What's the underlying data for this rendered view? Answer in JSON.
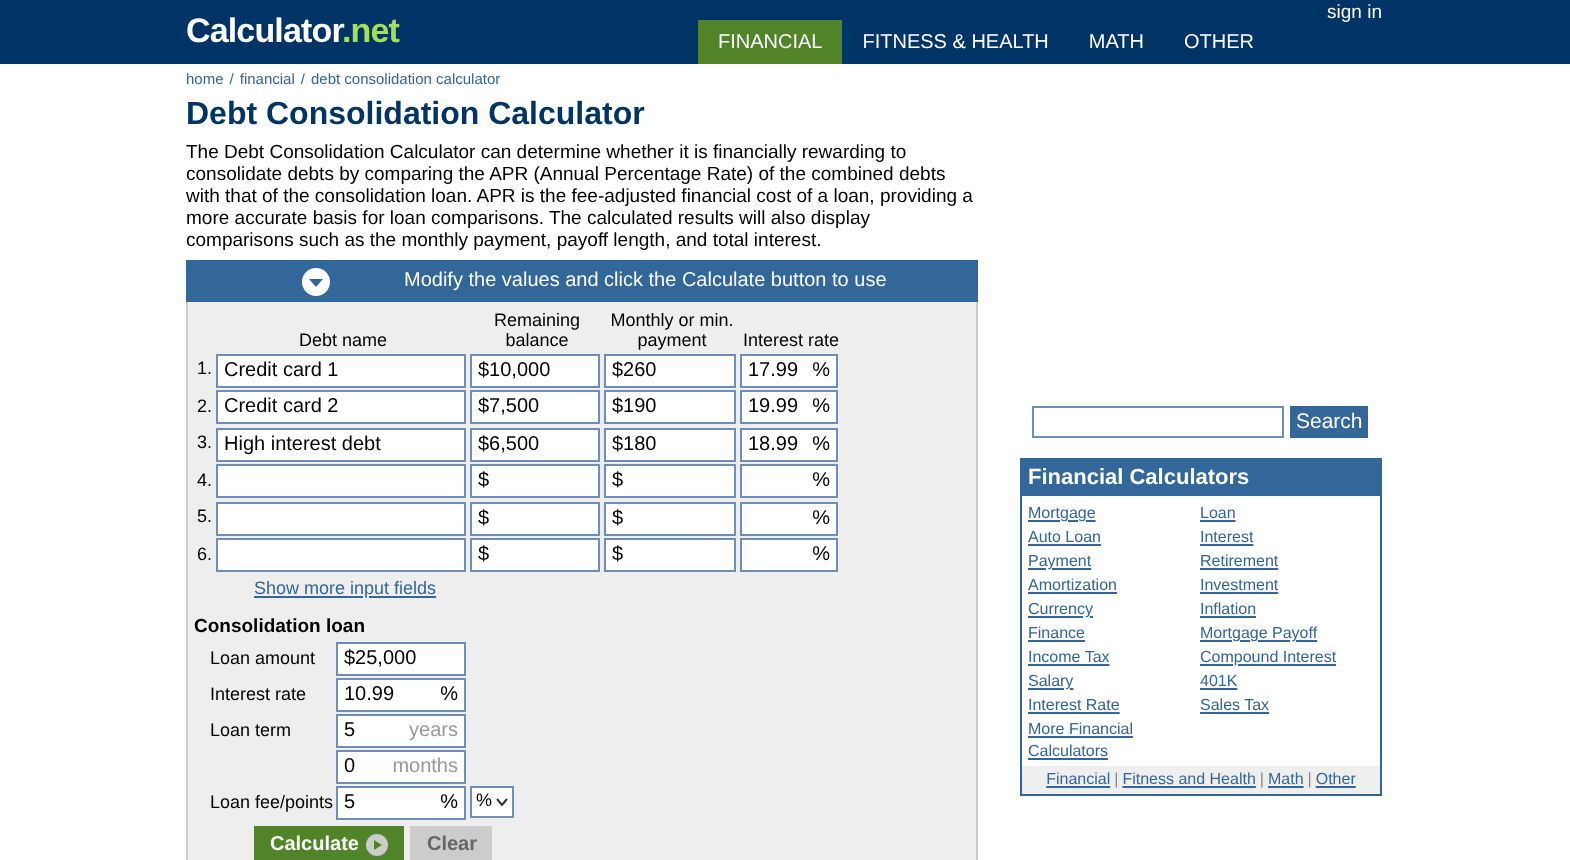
{
  "header": {
    "logo": "Calculator",
    "logo_suffix": ".net",
    "sign_in": "sign in",
    "tabs": [
      {
        "label": "FINANCIAL",
        "selected": true
      },
      {
        "label": "FITNESS & HEALTH",
        "selected": false
      },
      {
        "label": "MATH",
        "selected": false
      },
      {
        "label": "OTHER",
        "selected": false
      }
    ]
  },
  "breadcrumb": {
    "separator": "/",
    "items": [
      "home",
      "financial",
      "debt consolidation calculator"
    ]
  },
  "title": "Debt Consolidation Calculator",
  "description": "The Debt Consolidation Calculator can determine whether it is financially rewarding to consolidate debts by comparing the APR (Annual Percentage Rate) of the combined debts with that of the consolidation loan. APR is the fee-adjusted financial cost of a loan, providing a more accurate basis for loan comparisons. The calculated results will also display comparisons such as the monthly payment, payoff length, and total interest.",
  "banner": "Modify the values and click the Calculate button to use",
  "debts": {
    "columns": [
      "Debt name",
      "Remaining balance",
      "Monthly or min. payment",
      "Interest rate"
    ],
    "rows": [
      {
        "number": "1.",
        "name": "Credit card 1",
        "balance": "$10,000",
        "payment": "$260",
        "rate": "17.99",
        "unit": "%"
      },
      {
        "number": "2.",
        "name": "Credit card 2",
        "balance": "$7,500",
        "payment": "$190",
        "rate": "19.99",
        "unit": "%"
      },
      {
        "number": "3.",
        "name": "High interest debt",
        "balance": "$6,500",
        "payment": "$180",
        "rate": "18.99",
        "unit": "%"
      },
      {
        "number": "4.",
        "balance": "$",
        "payment": "$",
        "unit": "%"
      },
      {
        "number": "5.",
        "balance": "$",
        "payment": "$",
        "unit": "%"
      },
      {
        "number": "6.",
        "balance": "$",
        "payment": "$",
        "unit": "%"
      }
    ],
    "more_link": "Show more input fields"
  },
  "loan": {
    "heading": "Consolidation loan",
    "fields": [
      {
        "label": "Loan amount",
        "inputs": [
          {
            "value": "$25,000"
          }
        ]
      },
      {
        "label": "Interest rate",
        "inputs": [
          {
            "value": "10.99",
            "unit": "%"
          }
        ]
      },
      {
        "label": "Loan term",
        "inputs": [
          {
            "value": "5",
            "unit": "years"
          },
          {
            "value": "0",
            "unit": "months"
          }
        ]
      },
      {
        "label": "Loan fee/points",
        "inputs": [
          {
            "value": "5",
            "unit": "%"
          }
        ],
        "select": "%"
      }
    ]
  },
  "buttons": [
    {
      "label": "Calculate",
      "disabled": false
    },
    {
      "label": "Clear",
      "disabled": true
    }
  ],
  "sidebar": {
    "search_button": "Search",
    "box_title": "Financial Calculators",
    "links": [
      "Mortgage",
      "Loan",
      "Auto Loan",
      "Interest",
      "Payment",
      "Retirement",
      "Amortization",
      "Investment",
      "Currency",
      "Inflation",
      "Finance",
      "Mortgage Payoff",
      "Income Tax",
      "Compound Interest",
      "Salary",
      "401K",
      "Interest Rate",
      "Sales Tax",
      "More Financial Calculators"
    ],
    "footer_separator": "|",
    "footer_links": [
      "Financial",
      "Fitness and Health",
      "Math",
      "Other"
    ]
  }
}
